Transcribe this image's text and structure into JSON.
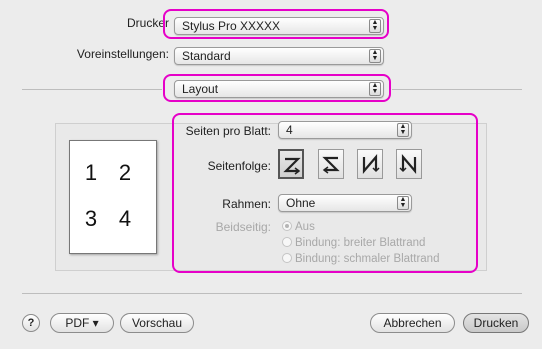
{
  "printer": {
    "label": "Drucker",
    "value": "Stylus Pro  XXXXX"
  },
  "presets": {
    "label": "Voreinstellungen:",
    "value": "Standard"
  },
  "section": {
    "value": "Layout"
  },
  "layout": {
    "pages_per_sheet": {
      "label": "Seiten pro Blatt:",
      "value": "4"
    },
    "order": {
      "label": "Seitenfolge:",
      "options": [
        "Z",
        "N-left",
        "N-mirror",
        "N"
      ],
      "selected_index": 0
    },
    "border": {
      "label": "Rahmen:",
      "value": "Ohne"
    },
    "duplex": {
      "label": "Beidseitig:",
      "options": [
        "Aus",
        "Bindung: breiter Blattrand",
        "Bindung: schmaler Blattrand"
      ],
      "selected_index": 0
    }
  },
  "preview_pages": [
    "1",
    "2",
    "3",
    "4"
  ],
  "footer": {
    "help": "?",
    "pdf": "PDF ▾",
    "preview": "Vorschau",
    "cancel": "Abbrechen",
    "print": "Drucken"
  },
  "colors": {
    "highlight": "#e600c8"
  }
}
